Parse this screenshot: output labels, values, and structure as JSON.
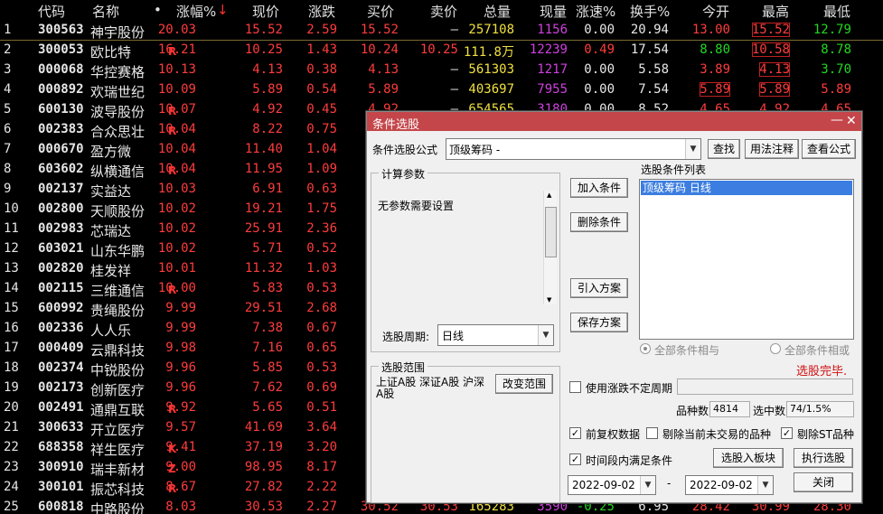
{
  "header": {
    "code": "代码",
    "name": "名称",
    "dot": "•",
    "chg_pct": "涨幅%",
    "sort_mark": "↓",
    "price": "现价",
    "change": "涨跌",
    "bid": "买价",
    "ask": "卖价",
    "volume": "总量",
    "cur_vol": "现量",
    "speed": "涨速%",
    "turnover": "换手%",
    "open": "今开",
    "high": "最高",
    "low": "最低"
  },
  "rows": [
    {
      "i": "1",
      "code": "300563",
      "name": "神宇股份",
      "flag": "",
      "pct": "20.03",
      "price": "15.52",
      "chg": "2.59",
      "bid": "15.52",
      "ask": "—",
      "vol": "257108",
      "cur": "1156",
      "spd": "0.00",
      "turn": "20.94",
      "open": "13.00",
      "high": "15.52",
      "low": "12.79"
    },
    {
      "i": "2",
      "code": "300053",
      "name": "欧比特",
      "flag": "R",
      "pct": "16.21",
      "price": "10.25",
      "chg": "1.43",
      "bid": "10.24",
      "ask": "10.25",
      "vol": "111.8万",
      "cur": "12239",
      "spd": "0.49",
      "turn": "17.54",
      "open": "8.80",
      "high": "10.58",
      "low": "8.78"
    },
    {
      "i": "3",
      "code": "000068",
      "name": "华控赛格",
      "flag": "",
      "pct": "10.13",
      "price": "4.13",
      "chg": "0.38",
      "bid": "4.13",
      "ask": "—",
      "vol": "561303",
      "cur": "1217",
      "spd": "0.00",
      "turn": "5.58",
      "open": "3.89",
      "high": "4.13",
      "low": "3.70"
    },
    {
      "i": "4",
      "code": "000892",
      "name": "欢瑞世纪",
      "flag": "",
      "pct": "10.09",
      "price": "5.89",
      "chg": "0.54",
      "bid": "5.89",
      "ask": "—",
      "vol": "403697",
      "cur": "7955",
      "spd": "0.00",
      "turn": "7.54",
      "open": "5.89",
      "high": "5.89",
      "low": "5.89"
    },
    {
      "i": "5",
      "code": "600130",
      "name": "波导股份",
      "flag": "R",
      "pct": "10.07",
      "price": "4.92",
      "chg": "0.45",
      "bid": "4.92",
      "ask": "—",
      "vol": "654565",
      "cur": "3180",
      "spd": "0.00",
      "turn": "8.52",
      "open": "4.65",
      "high": "4.92",
      "low": "4.65"
    },
    {
      "i": "6",
      "code": "002383",
      "name": "合众思壮",
      "flag": "R",
      "pct": "10.04",
      "price": "8.22",
      "chg": "0.75",
      "bid": "",
      "ask": "",
      "vol": "",
      "cur": "",
      "spd": "",
      "turn": "",
      "open": "",
      "high": "",
      "low": ""
    },
    {
      "i": "7",
      "code": "000670",
      "name": "盈方微",
      "flag": "",
      "pct": "10.04",
      "price": "11.40",
      "chg": "1.04",
      "bid": "",
      "ask": "",
      "vol": "",
      "cur": "",
      "spd": "",
      "turn": "",
      "open": "",
      "high": "",
      "low": ""
    },
    {
      "i": "8",
      "code": "603602",
      "name": "纵横通信",
      "flag": "R",
      "pct": "10.04",
      "price": "11.95",
      "chg": "1.09",
      "bid": "",
      "ask": "",
      "vol": "",
      "cur": "",
      "spd": "",
      "turn": "",
      "open": "",
      "high": "",
      "low": ""
    },
    {
      "i": "9",
      "code": "002137",
      "name": "实益达",
      "flag": "",
      "pct": "10.03",
      "price": "6.91",
      "chg": "0.63",
      "bid": "",
      "ask": "",
      "vol": "",
      "cur": "",
      "spd": "",
      "turn": "",
      "open": "",
      "high": "",
      "low": ""
    },
    {
      "i": "10",
      "code": "002800",
      "name": "天顺股份",
      "flag": "",
      "pct": "10.02",
      "price": "19.21",
      "chg": "1.75",
      "bid": "",
      "ask": "",
      "vol": "",
      "cur": "",
      "spd": "",
      "turn": "",
      "open": "",
      "high": "",
      "low": ""
    },
    {
      "i": "11",
      "code": "002983",
      "name": "芯瑞达",
      "flag": "",
      "pct": "10.02",
      "price": "25.91",
      "chg": "2.36",
      "bid": "",
      "ask": "",
      "vol": "",
      "cur": "",
      "spd": "",
      "turn": "",
      "open": "",
      "high": "",
      "low": ""
    },
    {
      "i": "12",
      "code": "603021",
      "name": "山东华鹏",
      "flag": "",
      "pct": "10.02",
      "price": "5.71",
      "chg": "0.52",
      "bid": "",
      "ask": "",
      "vol": "",
      "cur": "",
      "spd": "",
      "turn": "",
      "open": "",
      "high": "",
      "low": ""
    },
    {
      "i": "13",
      "code": "002820",
      "name": "桂发祥",
      "flag": "",
      "pct": "10.01",
      "price": "11.32",
      "chg": "1.03",
      "bid": "",
      "ask": "",
      "vol": "",
      "cur": "",
      "spd": "",
      "turn": "",
      "open": "",
      "high": "",
      "low": ""
    },
    {
      "i": "14",
      "code": "002115",
      "name": "三维通信",
      "flag": "R",
      "pct": "10.00",
      "price": "5.83",
      "chg": "0.53",
      "bid": "",
      "ask": "",
      "vol": "",
      "cur": "",
      "spd": "",
      "turn": "",
      "open": "",
      "high": "",
      "low": ""
    },
    {
      "i": "15",
      "code": "600992",
      "name": "贵绳股份",
      "flag": "",
      "pct": "9.99",
      "price": "29.51",
      "chg": "2.68",
      "bid": "",
      "ask": "",
      "vol": "",
      "cur": "",
      "spd": "",
      "turn": "",
      "open": "",
      "high": "",
      "low": ""
    },
    {
      "i": "16",
      "code": "002336",
      "name": "人人乐",
      "flag": "",
      "pct": "9.99",
      "price": "7.38",
      "chg": "0.67",
      "bid": "",
      "ask": "",
      "vol": "",
      "cur": "",
      "spd": "",
      "turn": "",
      "open": "",
      "high": "",
      "low": ""
    },
    {
      "i": "17",
      "code": "000409",
      "name": "云鼎科技",
      "flag": "",
      "pct": "9.98",
      "price": "7.16",
      "chg": "0.65",
      "bid": "",
      "ask": "",
      "vol": "",
      "cur": "",
      "spd": "",
      "turn": "",
      "open": "",
      "high": "",
      "low": ""
    },
    {
      "i": "18",
      "code": "002374",
      "name": "中锐股份",
      "flag": "",
      "pct": "9.96",
      "price": "5.85",
      "chg": "0.53",
      "bid": "",
      "ask": "",
      "vol": "",
      "cur": "",
      "spd": "",
      "turn": "",
      "open": "",
      "high": "",
      "low": ""
    },
    {
      "i": "19",
      "code": "002173",
      "name": "创新医疗",
      "flag": "",
      "pct": "9.96",
      "price": "7.62",
      "chg": "0.69",
      "bid": "",
      "ask": "",
      "vol": "",
      "cur": "",
      "spd": "",
      "turn": "",
      "open": "",
      "high": "",
      "low": ""
    },
    {
      "i": "20",
      "code": "002491",
      "name": "通鼎互联",
      "flag": "R",
      "pct": "9.92",
      "price": "5.65",
      "chg": "0.51",
      "bid": "",
      "ask": "",
      "vol": "",
      "cur": "",
      "spd": "",
      "turn": "",
      "open": "",
      "high": "",
      "low": ""
    },
    {
      "i": "21",
      "code": "300633",
      "name": "开立医疗",
      "flag": "",
      "pct": "9.57",
      "price": "41.69",
      "chg": "3.64",
      "bid": "",
      "ask": "",
      "vol": "",
      "cur": "",
      "spd": "",
      "turn": "",
      "open": "",
      "high": "",
      "low": ""
    },
    {
      "i": "22",
      "code": "688358",
      "name": "祥生医疗",
      "flag": "K",
      "pct": "9.41",
      "price": "37.19",
      "chg": "3.20",
      "bid": "",
      "ask": "",
      "vol": "",
      "cur": "",
      "spd": "",
      "turn": "",
      "open": "",
      "high": "",
      "low": ""
    },
    {
      "i": "23",
      "code": "300910",
      "name": "瑞丰新材",
      "flag": "Z",
      "pct": "9.00",
      "price": "98.95",
      "chg": "8.17",
      "bid": "",
      "ask": "",
      "vol": "",
      "cur": "",
      "spd": "",
      "turn": "",
      "open": "",
      "high": "",
      "low": ""
    },
    {
      "i": "24",
      "code": "300101",
      "name": "振芯科技",
      "flag": "R",
      "pct": "8.67",
      "price": "27.82",
      "chg": "2.22",
      "bid": "",
      "ask": "",
      "vol": "",
      "cur": "",
      "spd": "",
      "turn": "",
      "open": "",
      "high": "",
      "low": ""
    },
    {
      "i": "25",
      "code": "600818",
      "name": "中路股份",
      "flag": "",
      "pct": "8.03",
      "price": "30.53",
      "chg": "2.27",
      "bid": "30.52",
      "ask": "30.53",
      "vol": "165283",
      "cur": "3590",
      "spd": "-0.25",
      "turn": "6.95",
      "open": "28.42",
      "high": "30.99",
      "low": "28.30"
    }
  ],
  "dialog": {
    "title": "条件选股",
    "help": "?",
    "minimize": "—",
    "close": "✕",
    "formula_label": "条件选股公式",
    "formula_value": "顶级筹码      -",
    "find": "查找",
    "usage": "用法注释",
    "view_formula": "查看公式",
    "calc_params": "计算参数",
    "no_params": "无参数需要设置",
    "add_cond": "加入条件",
    "del_cond": "删除条件",
    "import_plan": "引入方案",
    "save_plan": "保存方案",
    "cond_list_title": "选股条件列表",
    "cond_items": [
      "顶级筹码  日线"
    ],
    "period_label": "选股周期:",
    "period_value": "日线",
    "all_and": "全部条件相与",
    "all_or": "全部条件相或",
    "done": "选股完毕.",
    "range_title": "选股范围",
    "range_text": "上证A股 深证A股 沪深A股",
    "change_range": "改变范围",
    "use_uncertain": "使用涨跌不定周期",
    "count_label": "品种数",
    "count_value": "4814",
    "hit_label": "选中数",
    "hit_value": "74/1.5%",
    "pre_adjust": "前复权数据",
    "exclude_untraded": "剔除当前未交易的品种",
    "exclude_st": "剔除ST品种",
    "time_period": "时间段内满足条件",
    "to_block": "选股入板块",
    "execute": "执行选股",
    "date_from": "2022-09-02",
    "date_sep": "-",
    "date_to": "2022-09-02",
    "close_btn": "关闭"
  }
}
